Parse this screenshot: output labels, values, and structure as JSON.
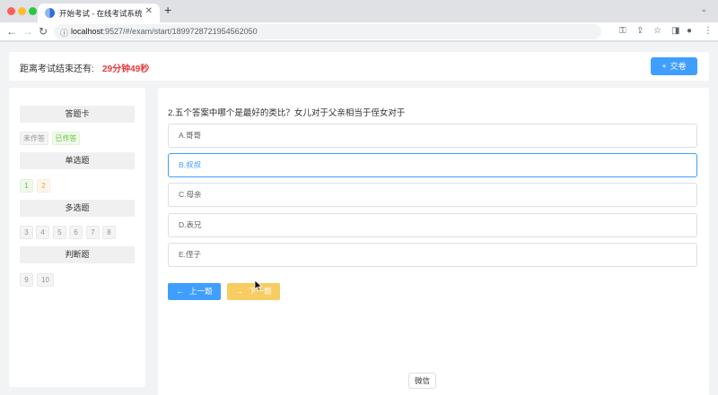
{
  "browser": {
    "tab_title": "开始考试 - 在线考试系统",
    "url_host": "localhost",
    "url_path": ":9527/#/exam/start/1899728721954562050"
  },
  "header": {
    "countdown_label": "距离考试结束还有:",
    "countdown_value": "29分钟49秒",
    "submit_label": "交卷"
  },
  "answer_card": {
    "title": "答题卡",
    "legend_unanswered": "未作答",
    "legend_answered": "已作答",
    "sections": [
      {
        "title": "单选题",
        "items": [
          "1",
          "2"
        ]
      },
      {
        "title": "多选题",
        "items": [
          "3",
          "4",
          "5",
          "6",
          "7",
          "8"
        ]
      },
      {
        "title": "判断题",
        "items": [
          "9",
          "10"
        ]
      }
    ]
  },
  "question": {
    "text": "2.五个答案中哪个是最好的类比？女儿对于父亲相当于侄女对于",
    "options": [
      "A.哥哥",
      "B.叔叔",
      "C.母亲",
      "D.表兄",
      "E.侄子"
    ],
    "selected_option": "B.叔叔",
    "prev_label": "上一题",
    "next_label": "下一题"
  },
  "tooltip": {
    "text": "微信"
  },
  "colors": {
    "primary": "#409eff",
    "warning": "#f7cd62",
    "danger": "#e4393c",
    "success": "#67c23a"
  }
}
